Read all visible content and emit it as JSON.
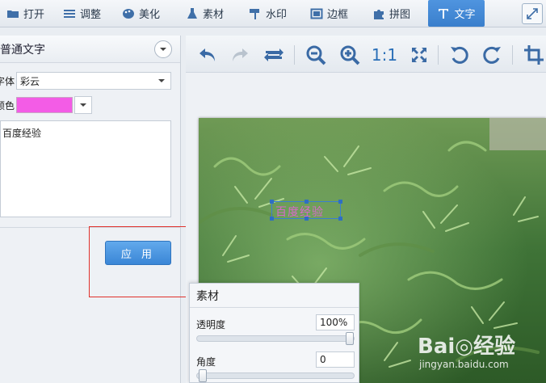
{
  "toolbar": {
    "items": [
      {
        "label": "打开",
        "icon": "folder-icon"
      },
      {
        "label": "调整",
        "icon": "sliders-icon"
      },
      {
        "label": "美化",
        "icon": "palette-icon"
      },
      {
        "label": "素材",
        "icon": "flask-icon"
      },
      {
        "label": "水印",
        "icon": "roller-icon"
      },
      {
        "label": "边框",
        "icon": "frame-icon"
      },
      {
        "label": "拼图",
        "icon": "puzzle-icon"
      },
      {
        "label": "文字",
        "icon": "text-t-icon",
        "active": true
      }
    ],
    "expand_icon": "expand-icon"
  },
  "left_panel": {
    "title": "普通文字",
    "font_label": "字体",
    "font_value": "彩云",
    "color_label": "颜色",
    "color_value": "#f35ce6",
    "text_value": "百度经验",
    "apply_label": "应 用"
  },
  "edit_toolbar": {
    "zoom_ratio_label": "1:1"
  },
  "canvas": {
    "selected_text": "百度经验"
  },
  "material_panel": {
    "title": "素材",
    "opacity_label": "透明度",
    "opacity_value": "100%",
    "angle_label": "角度",
    "angle_value": "0"
  },
  "watermark": {
    "logo": "Bai◎经验",
    "sub": "jingyan.baidu.com"
  },
  "colors": {
    "accent": "#3a86d6",
    "highlight": "#e0312b",
    "text_color": "#f35ce6"
  }
}
